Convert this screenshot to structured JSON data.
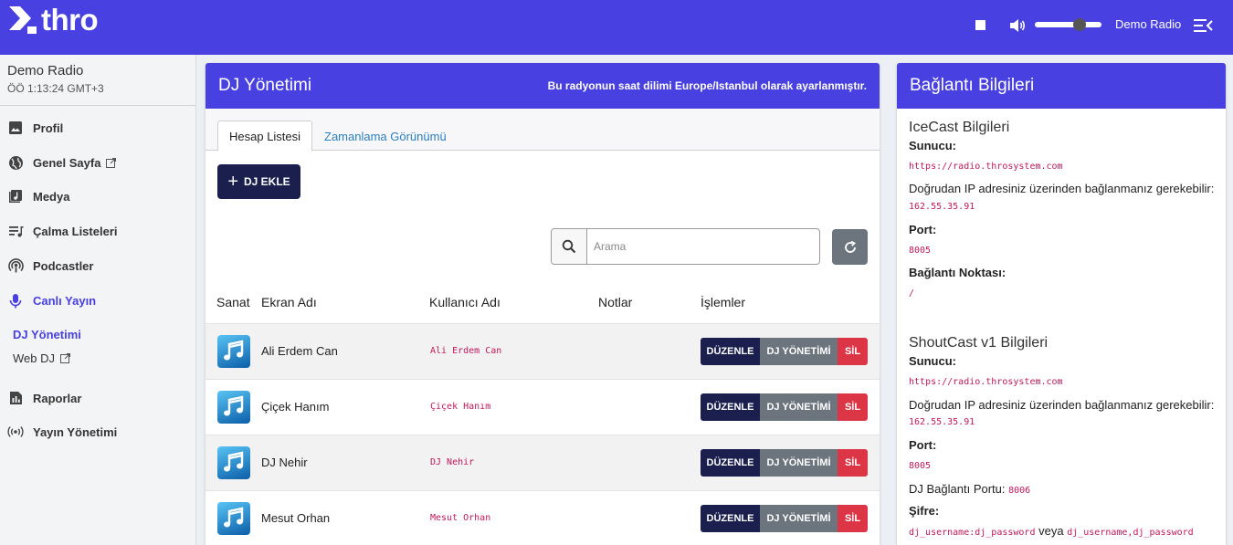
{
  "app": {
    "logo_text": "thro",
    "station_name": "Demo Radio"
  },
  "player": {
    "volume_fraction": 0.67
  },
  "sidebar": {
    "station": "Demo Radio",
    "time": "ÖÖ 1:13:24 GMT+3",
    "items": [
      {
        "label": "Profil",
        "icon": "image-icon"
      },
      {
        "label": "Genel Sayfa",
        "icon": "globe-icon"
      },
      {
        "label": "Medya",
        "icon": "music-library-icon"
      },
      {
        "label": "Çalma Listeleri",
        "icon": "playlist-icon"
      },
      {
        "label": "Podcastler",
        "icon": "podcast-icon"
      },
      {
        "label": "Canlı Yayın",
        "icon": "microphone-icon"
      },
      {
        "label": "Raporlar",
        "icon": "report-icon"
      },
      {
        "label": "Yayın Yönetimi",
        "icon": "broadcast-icon"
      }
    ],
    "subitems": [
      {
        "label": "DJ Yönetimi"
      },
      {
        "label": "Web DJ"
      }
    ]
  },
  "dj": {
    "title": "DJ Yönetimi",
    "timezone_note": "Bu radyonun saat dilimi Europe/Istanbul olarak ayarlanmıştır.",
    "tabs": [
      "Hesap Listesi",
      "Zamanlama Görünümü"
    ],
    "add_label": "DJ EKLE",
    "search_placeholder": "Arama",
    "columns": [
      "Sanat",
      "Ekran Adı",
      "Kullanıcı Adı",
      "Notlar",
      "İşlemler"
    ],
    "rows": [
      {
        "name": "Ali Erdem Can",
        "username": "Ali Erdem Can"
      },
      {
        "name": "Çiçek Hanım",
        "username": "Çiçek Hanım"
      },
      {
        "name": "DJ Nehir",
        "username": "DJ Nehir"
      },
      {
        "name": "Mesut Orhan",
        "username": "Mesut Orhan"
      }
    ],
    "actions": {
      "edit": "DÜZENLE",
      "manage": "DJ YÖNETİMİ",
      "delete": "SİL"
    }
  },
  "connection": {
    "title": "Bağlantı Bilgileri",
    "icecast": {
      "heading": "IceCast Bilgileri",
      "server_label": "Sunucu:",
      "server": "https://radio.throsystem.com",
      "ip_note": "Doğrudan IP adresiniz üzerinden bağlanmanız gerekebilir:",
      "ip": "162.55.35.91",
      "port_label": "Port:",
      "port": "8005",
      "mount_label": "Bağlantı Noktası:",
      "mount": "/"
    },
    "shoutcast": {
      "heading": "ShoutCast v1 Bilgileri",
      "server_label": "Sunucu:",
      "server": "https://radio.throsystem.com",
      "ip_note": "Doğrudan IP adresiniz üzerinden bağlanmanız gerekebilir:",
      "ip": "162.55.35.91",
      "port_label": "Port:",
      "port": "8005",
      "dj_port_label": "DJ Bağlantı Portu:",
      "dj_port": "8006",
      "password_label": "Şifre:",
      "password_a": "dj_username:dj_password",
      "password_or": "veya",
      "password_b": "dj_username,dj_password"
    }
  }
}
